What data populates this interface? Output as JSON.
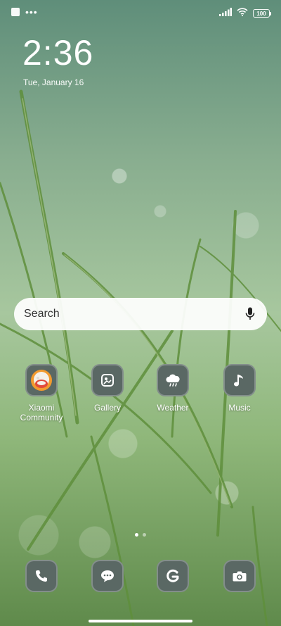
{
  "status_bar": {
    "left_icons": [
      "notification-square-icon",
      "more-dots-icon"
    ],
    "dots_text": "•••",
    "right_icons": [
      "signal-icon",
      "wifi-icon",
      "battery-icon"
    ],
    "battery": "100"
  },
  "lockscreen": {
    "time": "2:36",
    "date": "Tue, January 16"
  },
  "search": {
    "placeholder": "Search",
    "icon": "mic-icon"
  },
  "apps": [
    {
      "label": "Xiaomi Community",
      "icon": "xiaomi-community-icon"
    },
    {
      "label": "Gallery",
      "icon": "gallery-icon"
    },
    {
      "label": "Weather",
      "icon": "weather-icon"
    },
    {
      "label": "Music",
      "icon": "music-icon"
    }
  ],
  "page_indicator": {
    "pages": 2,
    "current": 1
  },
  "dock": [
    {
      "name": "phone",
      "icon": "phone-icon"
    },
    {
      "name": "messages",
      "icon": "messages-icon"
    },
    {
      "name": "browser",
      "icon": "browser-icon"
    },
    {
      "name": "camera",
      "icon": "camera-icon"
    }
  ],
  "colors": {
    "tile": "#5a6864",
    "accent": "#ffffff"
  }
}
